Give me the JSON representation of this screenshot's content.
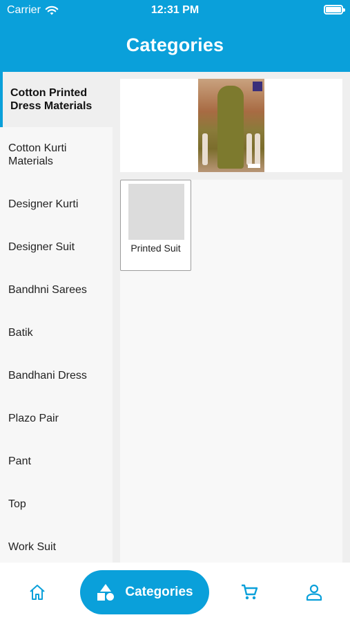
{
  "status_bar": {
    "carrier": "Carrier",
    "time": "12:31 PM"
  },
  "header": {
    "title": "Categories"
  },
  "sidebar": {
    "items": [
      {
        "label": "Cotton Printed Dress Materials",
        "active": true
      },
      {
        "label": "Cotton Kurti Materials"
      },
      {
        "label": "Designer Kurti"
      },
      {
        "label": "Designer Suit"
      },
      {
        "label": "Bandhni Sarees"
      },
      {
        "label": "Batik"
      },
      {
        "label": "Bandhani Dress"
      },
      {
        "label": "Plazo Pair"
      },
      {
        "label": "Pant"
      },
      {
        "label": "Top"
      },
      {
        "label": "Work Suit"
      }
    ]
  },
  "content": {
    "subcategories": [
      {
        "label": "Printed Suit"
      }
    ]
  },
  "bottom_nav": {
    "home_icon": "home-icon",
    "categories_label": "Categories",
    "categories_icon": "shapes-icon",
    "cart_icon": "cart-icon",
    "account_icon": "person-icon"
  },
  "colors": {
    "primary": "#0aa0da"
  }
}
